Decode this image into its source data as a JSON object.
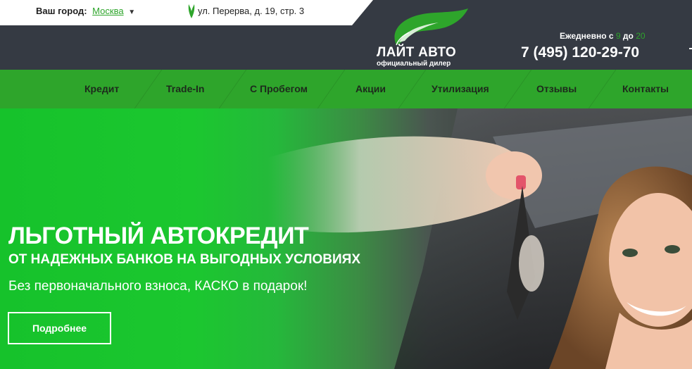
{
  "header": {
    "city_label": "Ваш город:",
    "city_value": "Москва",
    "address": "ул. Перерва, д. 19, стр. 3",
    "logo_title": "ЛАЙТ АВТО",
    "logo_subtitle": "официальный дилер",
    "hours_prefix": "Ежедневно с",
    "hours_from": "9",
    "hours_mid": "до",
    "hours_to": "20",
    "phone": "7 (495) 120-29-70"
  },
  "nav": {
    "items": [
      "Кредит",
      "Trade-In",
      "С Пробегом",
      "Акции",
      "Утилизация",
      "Отзывы",
      "Контакты"
    ]
  },
  "hero": {
    "title": "ЛЬГОТНЫЙ АВТОКРЕДИТ",
    "subtitle": "ОТ НАДЕЖНЫХ БАНКОВ НА ВЫГОДНЫХ УСЛОВИЯХ",
    "description": "Без первоначального взноса, КАСКО в подарок!",
    "button": "Подробнее"
  },
  "colors": {
    "accent": "#2ea52b",
    "header_dark": "#353a43"
  },
  "icons": [
    "chevron-down-icon",
    "map-pin-leaf-icon",
    "leaf-logo-icon"
  ]
}
